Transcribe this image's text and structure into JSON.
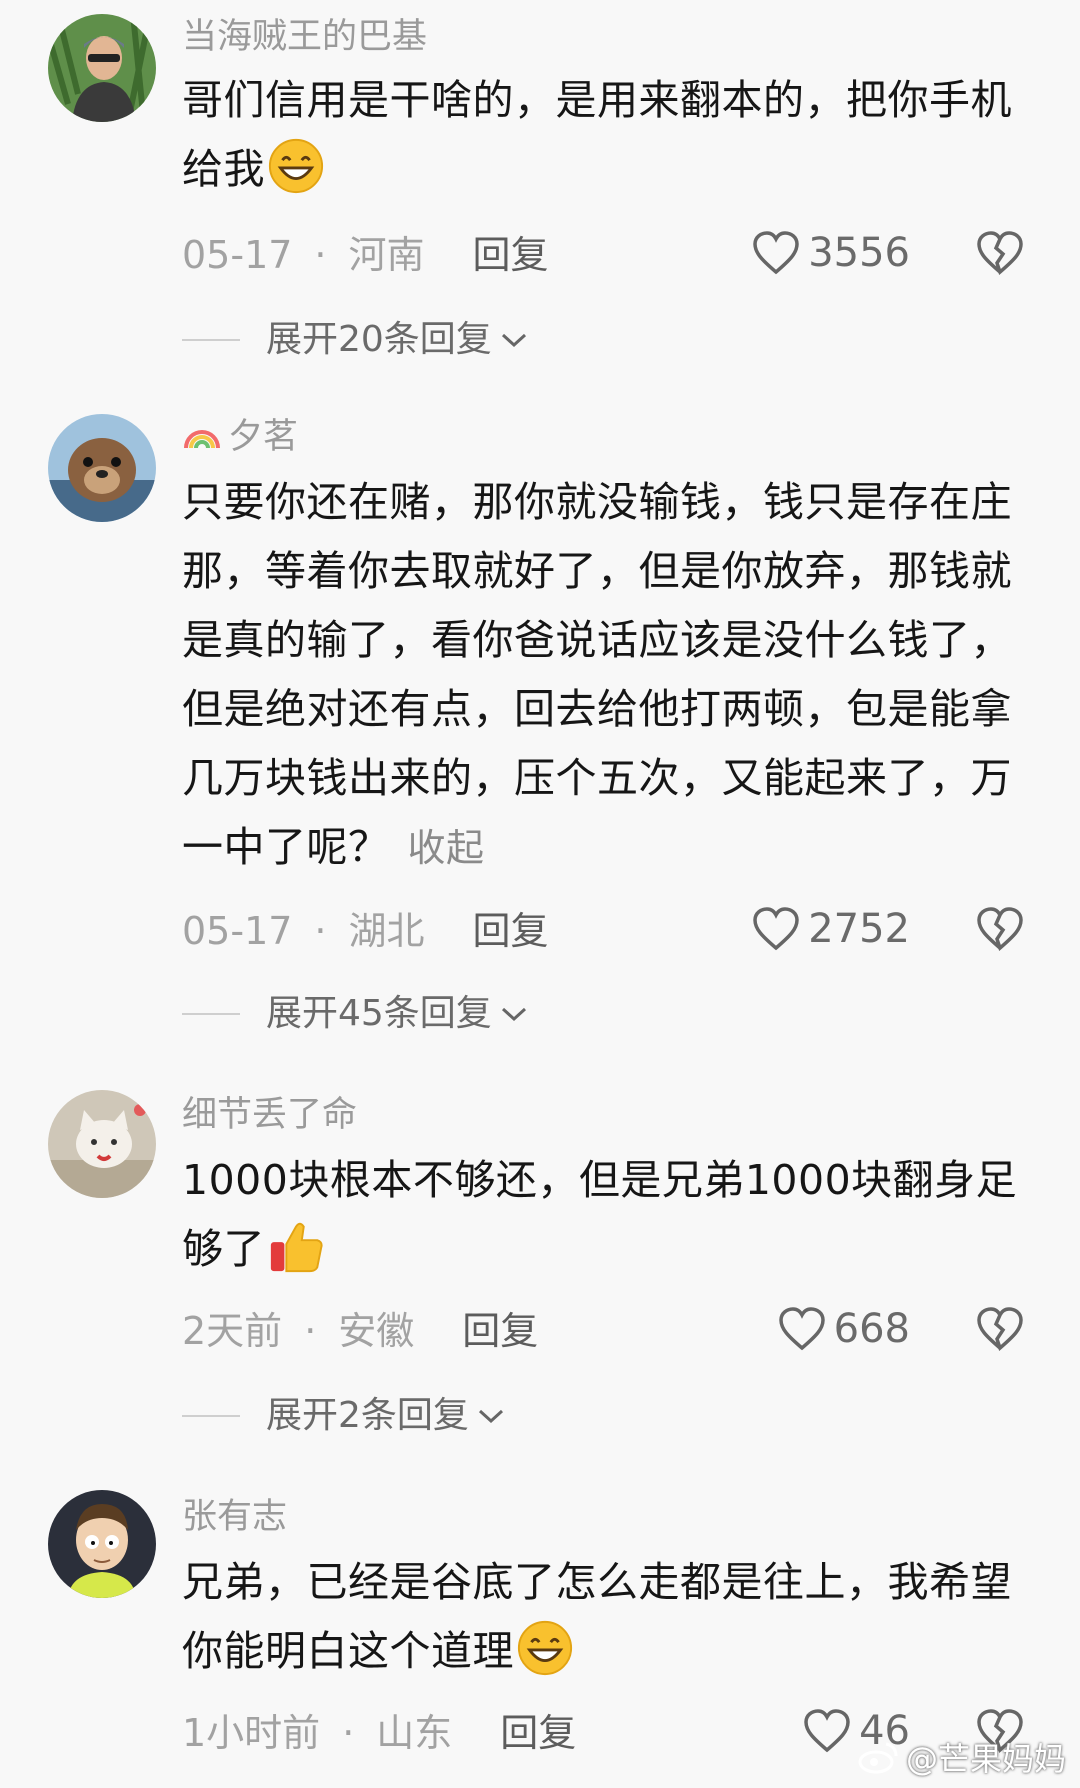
{
  "comments": [
    {
      "username": "当海贼王的巴基",
      "text": "哥们信用是干啥的，是用来翻本的，把你手机给我",
      "date": "05-17",
      "location": "河南",
      "reply_label": "回复",
      "likes": "3556",
      "expand_label": "展开20条回复",
      "avatar_icon": "man-with-sunglasses-avatar"
    },
    {
      "username": "夕茗",
      "text": "只要你还在赌，那你就没输钱，钱只是存在庄那，等着你去取就好了，但是你放弃，那钱就是真的输了，看你爸说话应该是没什么钱了，但是绝对还有点，回去给他打两顿，包是能拿几万块钱出来的，压个五次，又能起来了，万一中了呢？",
      "collapse_label": "收起",
      "date": "05-17",
      "location": "湖北",
      "reply_label": "回复",
      "likes": "2752",
      "expand_label": "展开45条回复",
      "avatar_icon": "otter-avatar"
    },
    {
      "username": "细节丢了命",
      "text": "1000块根本不够还，但是兄弟1000块翻身足够了",
      "date": "2天前",
      "location": "安徽",
      "reply_label": "回复",
      "likes": "668",
      "expand_label": "展开2条回复",
      "avatar_icon": "white-cat-avatar"
    },
    {
      "username": "张有志",
      "text": "兄弟，已经是谷底了怎么走都是往上，我希望你能明白这个道理",
      "date": "1小时前",
      "location": "山东",
      "reply_label": "回复",
      "likes": "46",
      "avatar_icon": "cartoon-boy-avatar"
    }
  ],
  "watermark": "@芒果妈妈",
  "colors": {
    "background": "#f8f8f8",
    "text": "#161616",
    "muted": "#9a9a9a"
  }
}
